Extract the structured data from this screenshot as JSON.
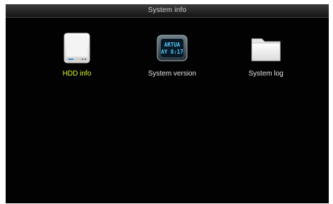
{
  "window": {
    "title": "System info"
  },
  "menu": {
    "items": [
      {
        "label": "HDD info",
        "icon": "hard-drive-icon",
        "selected": true
      },
      {
        "label": "System version",
        "icon": "version-display-icon",
        "selected": false
      },
      {
        "label": "System log",
        "icon": "folder-icon",
        "selected": false
      }
    ]
  },
  "icons": {
    "version_display_line1": "ARTUA",
    "version_display_line2": "AY 8:17"
  },
  "colors": {
    "background": "#020202",
    "selected_label": "#d8ff2d",
    "label": "#e6e6e6",
    "title": "#d4d4d4",
    "display_text": "#55caff"
  }
}
